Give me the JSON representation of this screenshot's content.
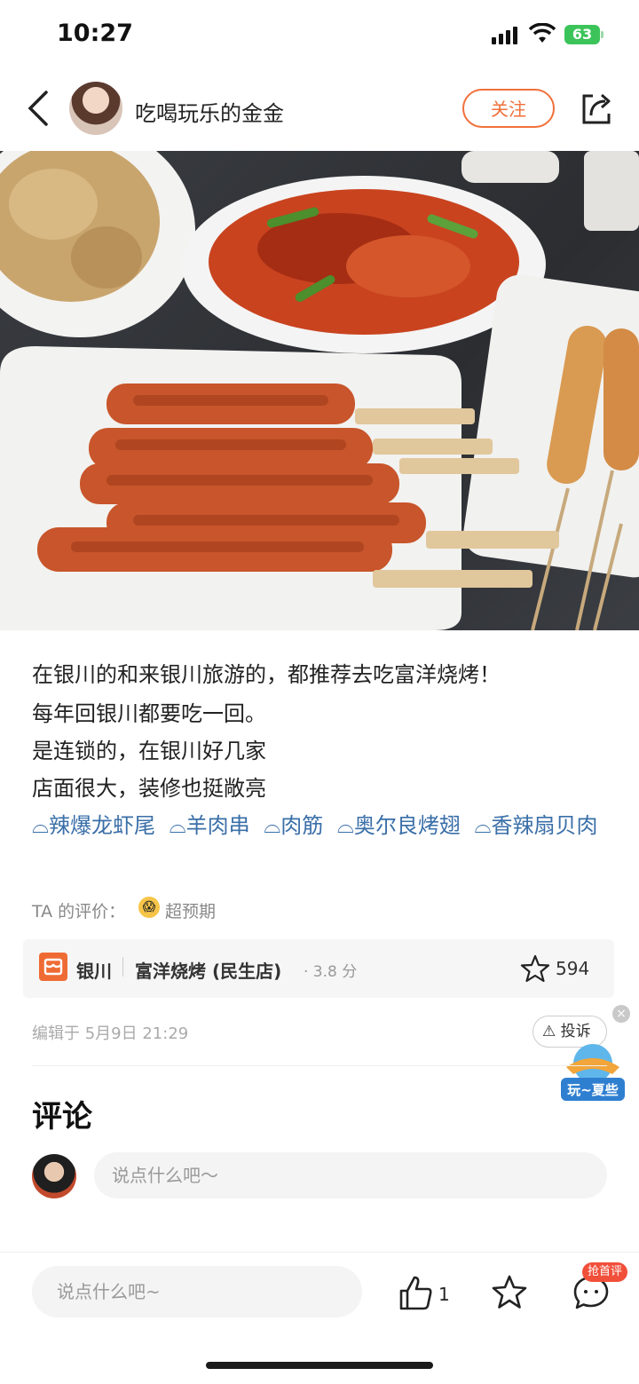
{
  "status_bar": {
    "time": "10:27",
    "battery": "63"
  },
  "header": {
    "username": "吃喝玩乐的金金",
    "follow_label": "关注"
  },
  "post": {
    "lines": [
      "在银川的和来银川旅游的，都推荐去吃富洋烧烤！",
      "每年回银川都要吃一回。",
      "是连锁的，在银川好几家",
      "店面很大，装修也挺敞亮"
    ],
    "tags": [
      "辣爆龙虾尾",
      "羊肉串",
      "肉筋",
      "奥尔良烤翅",
      "香辣扇贝肉"
    ],
    "rating_label": "TA 的评价：",
    "rating_value": "超预期"
  },
  "shop": {
    "city": "银川",
    "name": "富洋烧烤 (民生店)",
    "score": "· 3.8 分",
    "favorites": "594"
  },
  "meta": {
    "edit_time": "编辑于 5月9日 21:29",
    "report_label": "投诉",
    "badge_text": "玩~夏些"
  },
  "comments": {
    "title": "评论",
    "placeholder": "说点什么吧～"
  },
  "bottom_bar": {
    "input_placeholder": "说点什么吧~",
    "like_count": "1",
    "first_comment_badge": "抢首评"
  },
  "colors": {
    "accent_orange": "#f0703a",
    "tag_blue": "#3a6fa8",
    "shop_logo": "#ef6b34"
  }
}
